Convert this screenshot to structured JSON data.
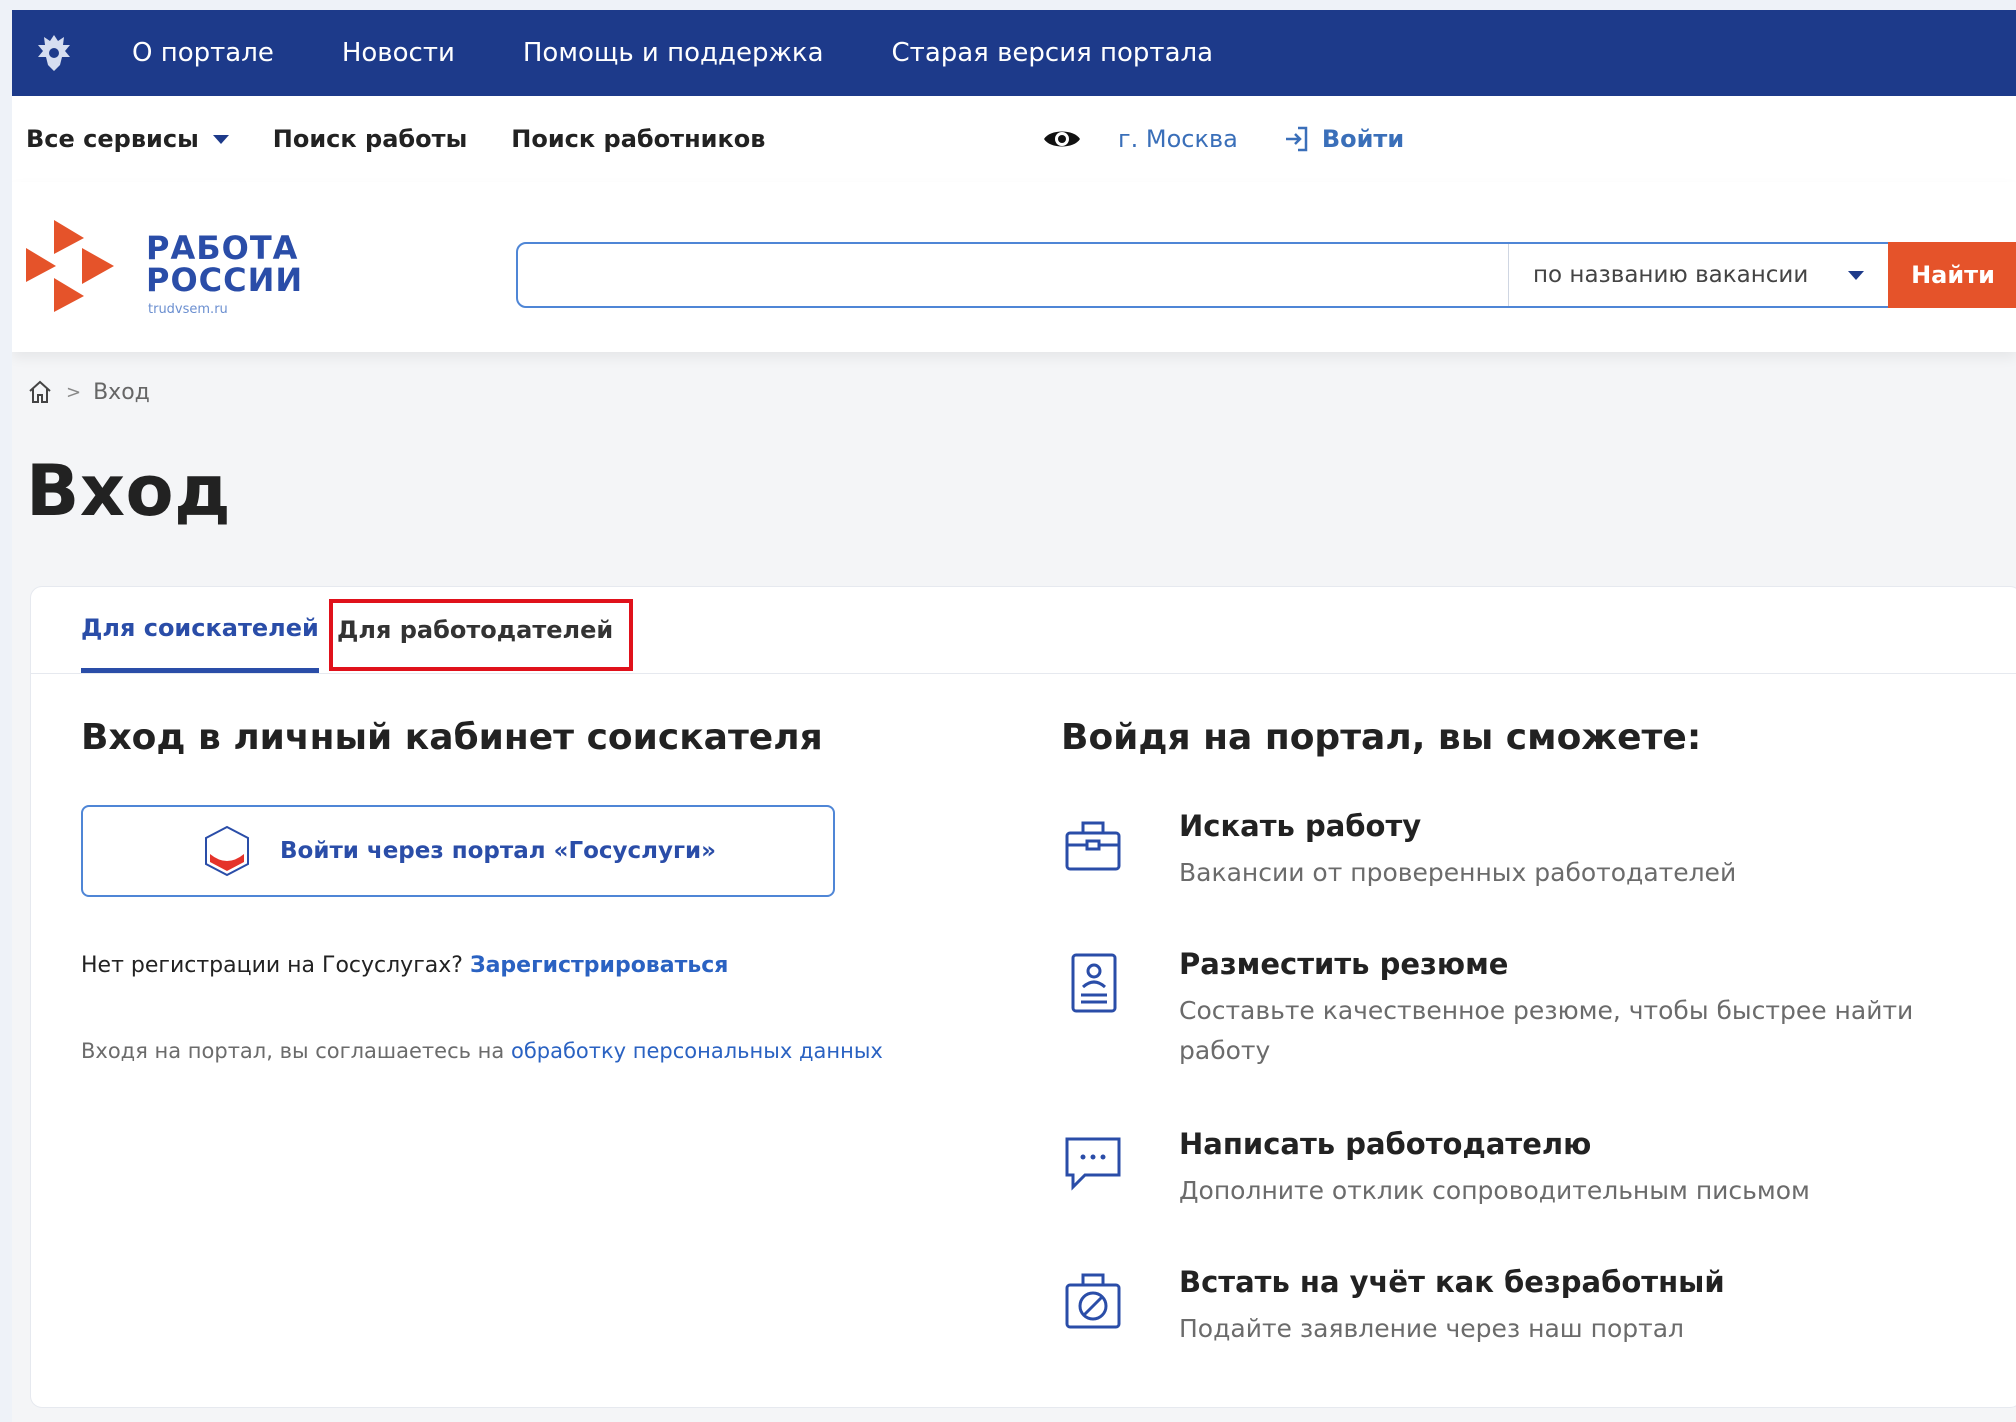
{
  "topbar": {
    "links": [
      "О портале",
      "Новости",
      "Помощь и поддержка",
      "Старая версия портала"
    ],
    "emblem_icon": "coat-of-arms-icon",
    "bg": "#1d3a8a"
  },
  "subnav": {
    "all_services": "Все сервисы",
    "find_job": "Поиск работы",
    "find_workers": "Поиск работников",
    "city": "г. Москва",
    "login": "Войти"
  },
  "logo": {
    "line1": "РАБОТА",
    "line2": "РОССИИ",
    "domain": "trudvsem.ru"
  },
  "search": {
    "query": "",
    "mode": "по названию вакансии",
    "button": "Найти",
    "accent": "#e5532a"
  },
  "breadcrumb": {
    "current": "Вход"
  },
  "page_title": "Вход",
  "tabs": {
    "seekers": "Для соискателей",
    "employers": "Для работодателей"
  },
  "login_panel": {
    "heading": "Вход в личный кабинет соискателя",
    "gosuslugi_button": "Войти через портал «Госуслуги»",
    "no_reg_text": "Нет регистрации на Госуслугах?",
    "register_link": "Зарегистрироваться",
    "consent_text": "Входя на портал, вы соглашаетесь на",
    "consent_link": "обработку персональных данных"
  },
  "benefits": {
    "heading": "Войдя на портал, вы сможете:",
    "items": [
      {
        "title": "Искать работу",
        "desc": "Вакансии от проверенных работодателей",
        "icon": "briefcase-icon"
      },
      {
        "title": "Разместить резюме",
        "desc": "Составьте качественное резюме, чтобы быстрее найти работу",
        "icon": "resume-icon"
      },
      {
        "title": "Написать работодателю",
        "desc": "Дополните отклик сопроводительным письмом",
        "icon": "chat-icon"
      },
      {
        "title": "Встать на учёт как безработный",
        "desc": "Подайте заявление через наш портал",
        "icon": "unemployed-icon"
      }
    ]
  }
}
